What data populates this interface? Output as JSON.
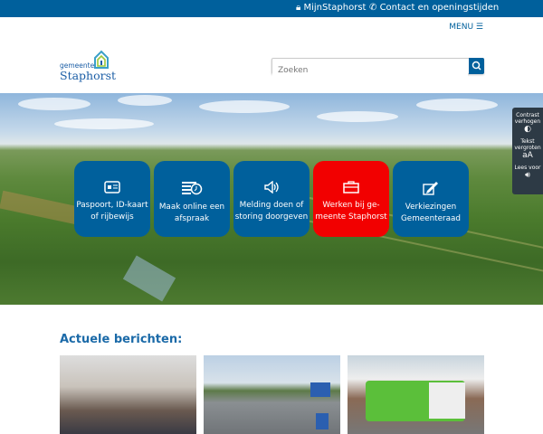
{
  "topbar": {
    "mijn": "MijnStaphorst",
    "contact": "Contact en openingstijden"
  },
  "header": {
    "menu": "MENU",
    "logo_small": "gemeente",
    "logo_large": "Staphorst",
    "search_placeholder": "Zoeken"
  },
  "tiles": [
    {
      "label": "Paspoort, ID-kaart of rijbewijs",
      "icon": "id-card-icon"
    },
    {
      "label": "Maak online een afspraak",
      "icon": "calendar-clock-icon"
    },
    {
      "label": "Melding doen of storing doorgeven",
      "icon": "speaker-icon"
    },
    {
      "label": "Werken bij ge-meente Staphorst",
      "icon": "briefcase-icon"
    },
    {
      "label": "Verkiezingen Gemeenteraad",
      "icon": "pencil-icon"
    }
  ],
  "accessibility": {
    "contrast": "Contrast verhogen",
    "text": "Tekst vergroten",
    "text_icon": "aA",
    "read": "Lees voor"
  },
  "news": {
    "title": "Actuele berichten:"
  },
  "colors": {
    "primary": "#00609c",
    "highlight": "#f20000"
  }
}
